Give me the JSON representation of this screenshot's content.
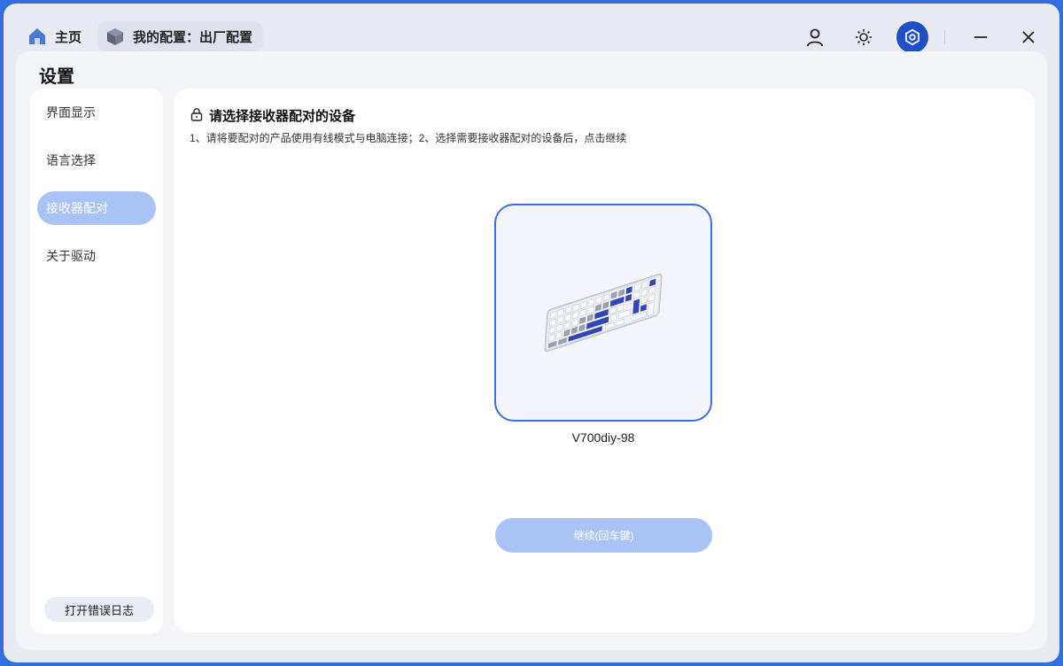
{
  "topbar": {
    "home_tab": "主页",
    "config_tab": "我的配置：出厂配置"
  },
  "panel": {
    "title": "设置"
  },
  "sidebar": {
    "items": [
      {
        "label": "界面显示",
        "active": false
      },
      {
        "label": "语言选择",
        "active": false
      },
      {
        "label": "接收器配对",
        "active": true
      },
      {
        "label": "关于驱动",
        "active": false
      }
    ],
    "log_button": "打开错误日志"
  },
  "content": {
    "heading": "请选择接收器配对的设备",
    "subtitle": "1、请将要配对的产品使用有线模式与电脑连接；2、选择需要接收器配对的设备后，点击继续",
    "device": {
      "name": "V700diy-98"
    },
    "continue_button": "继续(回车键)"
  },
  "colors": {
    "accent": "#1f4ec8",
    "accent_light": "#a9c3f6",
    "card_border": "#3a6fd8",
    "background": "#2f6fe0"
  }
}
